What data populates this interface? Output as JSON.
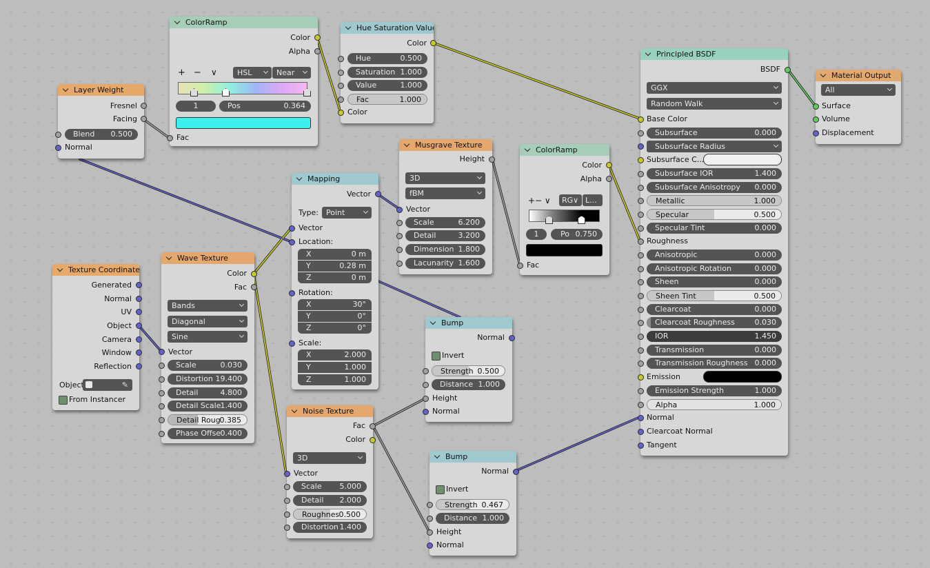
{
  "nodes": {
    "layer_weight": {
      "title": "Layer Weight",
      "outputs": [
        "Fresnel",
        "Facing"
      ],
      "blend_label": "Blend",
      "blend_value": "0.500",
      "normal": "Normal"
    },
    "colorramp1": {
      "title": "ColorRamp",
      "outputs": [
        "Color",
        "Alpha"
      ],
      "controls": [
        "+",
        "−",
        "∨"
      ],
      "mode": "HSL",
      "interp": "Near",
      "index": "1",
      "pos_label": "Pos",
      "pos_value": "0.364",
      "fac": "Fac",
      "color_hex": "#3cf0f0"
    },
    "hsv": {
      "title": "Hue Saturation Value",
      "output": "Color",
      "fields": [
        {
          "name": "Hue",
          "value": "0.500"
        },
        {
          "name": "Saturation",
          "value": "1.000"
        },
        {
          "name": "Value",
          "value": "1.000"
        },
        {
          "name": "Fac",
          "value": "1.000"
        }
      ],
      "color_in": "Color"
    },
    "texcoord": {
      "title": "Texture Coordinate",
      "outputs": [
        "Generated",
        "Normal",
        "UV",
        "Object",
        "Camera",
        "Window",
        "Reflection"
      ],
      "object_label": "Object:",
      "from_instancer": "From Instancer"
    },
    "wave": {
      "title": "Wave Texture",
      "outputs": [
        "Color",
        "Fac"
      ],
      "dropdowns": [
        "Bands",
        "Diagonal",
        "Sine"
      ],
      "vector": "Vector",
      "fields": [
        {
          "name": "Scale",
          "value": "0.030"
        },
        {
          "name": "Distortion",
          "value": "19.400"
        },
        {
          "name": "Detail",
          "value": "4.800"
        },
        {
          "name": "Detail Scale",
          "value": "1.400"
        },
        {
          "name": "Detail Roug",
          "value": "0.385"
        },
        {
          "name": "Phase Offse",
          "value": "0.400"
        }
      ]
    },
    "mapping": {
      "title": "Mapping",
      "output": "Vector",
      "type_label": "Type:",
      "type_value": "Point",
      "vector_in": "Vector",
      "location": "Location:",
      "loc": [
        {
          "axis": "X",
          "value": "0 m"
        },
        {
          "axis": "Y",
          "value": "0.28 m"
        },
        {
          "axis": "Z",
          "value": "0 m"
        }
      ],
      "rotation": "Rotation:",
      "rot": [
        {
          "axis": "X",
          "value": "30°"
        },
        {
          "axis": "Y",
          "value": "0°"
        },
        {
          "axis": "Z",
          "value": "0°"
        }
      ],
      "scale": "Scale:",
      "scl": [
        {
          "axis": "X",
          "value": "2.000"
        },
        {
          "axis": "Y",
          "value": "1.000"
        },
        {
          "axis": "Z",
          "value": "1.000"
        }
      ]
    },
    "musgrave": {
      "title": "Musgrave Texture",
      "output": "Height",
      "dims": "3D",
      "type": "fBM",
      "vector": "Vector",
      "fields": [
        {
          "name": "Scale",
          "value": "6.200"
        },
        {
          "name": "Detail",
          "value": "3.200"
        },
        {
          "name": "Dimension",
          "value": "1.800"
        },
        {
          "name": "Lacunarity",
          "value": "1.600"
        }
      ]
    },
    "colorramp2": {
      "title": "ColorRamp",
      "outputs": [
        "Color",
        "Alpha"
      ],
      "controls": "+− ∨",
      "mode": "RG∨",
      "interp": "L...",
      "index": "1",
      "pos_label": "Po",
      "pos_value": "0.750",
      "fac": "Fac"
    },
    "bump1": {
      "title": "Bump",
      "output": "Normal",
      "invert": "Invert",
      "strength_label": "Strength",
      "strength_value": "0.500",
      "distance_label": "Distance",
      "distance_value": "1.000",
      "height": "Height",
      "normal": "Normal"
    },
    "noise": {
      "title": "Noise Texture",
      "outputs": [
        "Fac",
        "Color"
      ],
      "dims": "3D",
      "vector": "Vector",
      "fields": [
        {
          "name": "Scale",
          "value": "5.000"
        },
        {
          "name": "Detail",
          "value": "2.000"
        },
        {
          "name": "Roughnes",
          "value": "0.500"
        },
        {
          "name": "Distortion",
          "value": "1.400"
        }
      ]
    },
    "bump2": {
      "title": "Bump",
      "output": "Normal",
      "invert": "Invert",
      "strength_label": "Strength",
      "strength_value": "0.467",
      "distance_label": "Distance",
      "distance_value": "1.000",
      "height": "Height",
      "normal": "Normal"
    },
    "principled": {
      "title": "Principled BSDF",
      "output": "BSDF",
      "distribution": "GGX",
      "subsurface_method": "Random Walk",
      "base_color": "Base Color",
      "subsurface": {
        "name": "Subsurface",
        "value": "0.000"
      },
      "subsurface_radius": "Subsurface Radius",
      "subsurface_color": "Subsurface C...",
      "fields": [
        {
          "name": "Subsurface IOR",
          "value": "1.400"
        },
        {
          "name": "Subsurface Anisotropy",
          "value": "0.000"
        },
        {
          "name": "Metallic",
          "value": "1.000"
        },
        {
          "name": "Specular",
          "value": "0.500"
        },
        {
          "name": "Specular Tint",
          "value": "0.000"
        }
      ],
      "roughness": "Roughness",
      "fields2": [
        {
          "name": "Anisotropic",
          "value": "0.000"
        },
        {
          "name": "Anisotropic Rotation",
          "value": "0.000"
        },
        {
          "name": "Sheen",
          "value": "0.000"
        },
        {
          "name": "Sheen Tint",
          "value": "0.500"
        },
        {
          "name": "Clearcoat",
          "value": "0.000"
        },
        {
          "name": "Clearcoat Roughness",
          "value": "0.030"
        },
        {
          "name": "IOR",
          "value": "1.450"
        },
        {
          "name": "Transmission",
          "value": "0.000"
        },
        {
          "name": "Transmission Roughness",
          "value": "0.000"
        }
      ],
      "emission": "Emission",
      "emission_strength": {
        "name": "Emission Strength",
        "value": "1.000"
      },
      "alpha": {
        "name": "Alpha",
        "value": "1.000"
      },
      "inputs_tail": [
        "Normal",
        "Clearcoat Normal",
        "Tangent"
      ]
    },
    "material_output": {
      "title": "Material Output",
      "target": "All",
      "inputs": [
        "Surface",
        "Volume",
        "Displacement"
      ]
    }
  },
  "colors": {
    "float_socket": "#a1a1a1",
    "color_socket": "#c7c729",
    "vector_socket": "#6363c7",
    "shader_socket": "#63c763"
  }
}
